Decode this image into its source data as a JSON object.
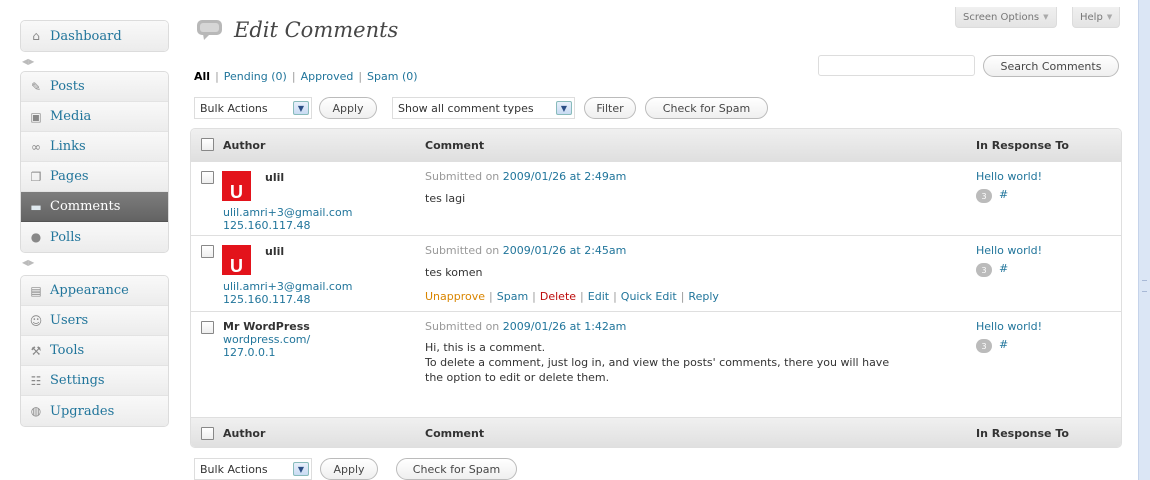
{
  "header": {
    "screen_options": "Screen Options",
    "help": "Help",
    "page_title": "Edit Comments"
  },
  "sidebar": {
    "group1": [
      {
        "label": "Dashboard",
        "icon": "house-icon"
      }
    ],
    "group2": [
      {
        "label": "Posts",
        "icon": "pin-icon"
      },
      {
        "label": "Media",
        "icon": "media-icon"
      },
      {
        "label": "Links",
        "icon": "link-icon"
      },
      {
        "label": "Pages",
        "icon": "pages-icon"
      },
      {
        "label": "Comments",
        "icon": "comment-bubble-icon",
        "current": true
      },
      {
        "label": "Polls",
        "icon": "poll-icon"
      }
    ],
    "group3": [
      {
        "label": "Appearance",
        "icon": "appearance-icon"
      },
      {
        "label": "Users",
        "icon": "users-icon"
      },
      {
        "label": "Tools",
        "icon": "tools-icon"
      },
      {
        "label": "Settings",
        "icon": "settings-icon"
      },
      {
        "label": "Upgrades",
        "icon": "upgrades-icon"
      }
    ]
  },
  "filters": {
    "all": "All",
    "pending": "Pending (0)",
    "approved": "Approved",
    "spam": "Spam (0)"
  },
  "search": {
    "value": "",
    "button": "Search Comments"
  },
  "toolbar_top": {
    "bulk_actions": "Bulk Actions",
    "apply": "Apply",
    "comment_types": "Show all comment types",
    "filter": "Filter",
    "check_spam": "Check for Spam"
  },
  "table": {
    "columns": {
      "author": "Author",
      "comment": "Comment",
      "response": "In Response To"
    },
    "rows": [
      {
        "author": "ulil",
        "email": "ulil.amri+3@gmail.com",
        "ip": "125.160.117.48",
        "submitted_prefix": "Submitted on ",
        "date": "2009/01/26 at 2:49am",
        "text": "tes lagi",
        "post": "Hello world!",
        "count": "3",
        "hash": "#"
      },
      {
        "author": "ulil",
        "email": "ulil.amri+3@gmail.com",
        "ip": "125.160.117.48",
        "submitted_prefix": "Submitted on ",
        "date": "2009/01/26 at 2:45am",
        "text": "tes komen",
        "post": "Hello world!",
        "count": "3",
        "hash": "#",
        "actions": {
          "unapprove": "Unapprove",
          "spam": "Spam",
          "delete": "Delete",
          "edit": "Edit",
          "quick_edit": "Quick Edit",
          "reply": "Reply"
        }
      },
      {
        "author": "Mr WordPress",
        "url": "wordpress.com/",
        "ip": "127.0.0.1",
        "submitted_prefix": "Submitted on ",
        "date": "2009/01/26 at 1:42am",
        "text_line1": "Hi, this is a comment.",
        "text_line2": "To delete a comment, just log in, and view the posts' comments, there you will have",
        "text_line3": "the option to edit or delete them.",
        "post": "Hello world!",
        "count": "3",
        "hash": "#"
      }
    ]
  },
  "toolbar_bottom": {
    "bulk_actions": "Bulk Actions",
    "apply": "Apply",
    "check_spam": "Check for Spam"
  },
  "colors": {
    "link": "#21759b",
    "current_menu": "#6d6d6d",
    "unapprove": "#d98500",
    "delete": "#bc0b0b",
    "avatar": "#e3131b"
  }
}
